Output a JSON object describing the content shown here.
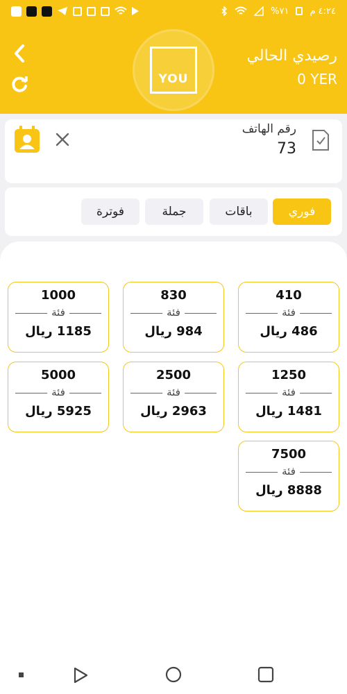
{
  "status_bar": {
    "time": "٤:٢٤ م",
    "battery": "%٧١"
  },
  "header": {
    "balance_label": "رصيدي الحالي",
    "balance_value": "0 YER",
    "logo_text": "YOU"
  },
  "phone": {
    "label": "رقم الهاتف",
    "value": "73"
  },
  "tabs": [
    {
      "label": "فوري",
      "active": true
    },
    {
      "label": "باقات",
      "active": false
    },
    {
      "label": "جملة",
      "active": false
    },
    {
      "label": "فوترة",
      "active": false
    }
  ],
  "denominations": [
    {
      "amount": "410",
      "fia": "فئة",
      "price": "486 ريال"
    },
    {
      "amount": "830",
      "fia": "فئة",
      "price": "984 ريال"
    },
    {
      "amount": "1000",
      "fia": "فئة",
      "price": "1185 ريال"
    },
    {
      "amount": "1250",
      "fia": "فئة",
      "price": "1481 ريال"
    },
    {
      "amount": "2500",
      "fia": "فئة",
      "price": "2963 ريال"
    },
    {
      "amount": "5000",
      "fia": "فئة",
      "price": "5925 ريال"
    },
    {
      "amount": "7500",
      "fia": "فئة",
      "price": "8888 ريال"
    }
  ],
  "colors": {
    "accent": "#f9c514",
    "card_border": "#f5c61a"
  }
}
